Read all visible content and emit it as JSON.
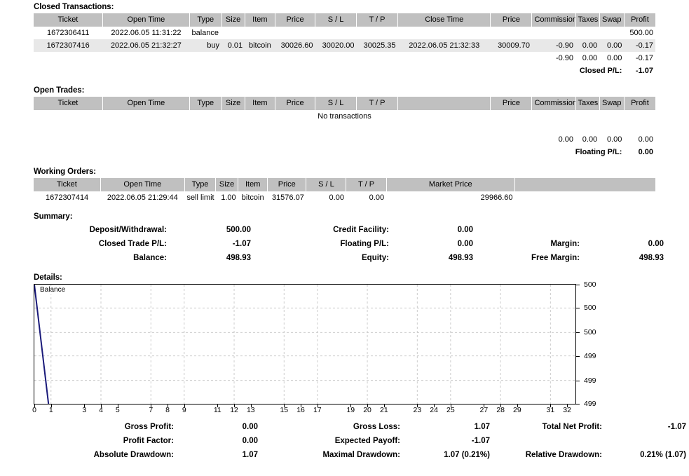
{
  "sections": {
    "closed_title": "Closed Transactions:",
    "open_title": "Open Trades:",
    "working_title": "Working Orders:",
    "summary_title": "Summary:",
    "details_title": "Details:"
  },
  "closed_transactions": {
    "columns": [
      "Ticket",
      "Open Time",
      "Type",
      "Size",
      "Item",
      "Price",
      "S / L",
      "T / P",
      "Close Time",
      "Price",
      "Commission",
      "Taxes",
      "Swap",
      "Profit"
    ],
    "rows": [
      {
        "ticket": "1672306411",
        "open_time": "2022.06.05 11:31:22",
        "type": "balance",
        "size": "",
        "item": "",
        "price": "",
        "sl": "",
        "tp": "",
        "close_time": "",
        "close_price": "",
        "commission": "",
        "taxes": "",
        "swap": "",
        "profit": "500.00"
      },
      {
        "ticket": "1672307416",
        "open_time": "2022.06.05 21:32:27",
        "type": "buy",
        "size": "0.01",
        "item": "bitcoin",
        "price": "30026.60",
        "sl": "30020.00",
        "tp": "30025.35",
        "close_time": "2022.06.05 21:32:33",
        "close_price": "30009.70",
        "commission": "-0.90",
        "taxes": "0.00",
        "swap": "0.00",
        "profit": "-0.17"
      }
    ],
    "totals": {
      "commission": "-0.90",
      "taxes": "0.00",
      "swap": "0.00",
      "profit": "-0.17"
    },
    "pl_label": "Closed P/L:",
    "pl_value": "-1.07"
  },
  "open_trades": {
    "columns": [
      "Ticket",
      "Open Time",
      "Type",
      "Size",
      "Item",
      "Price",
      "S / L",
      "T / P",
      "",
      "Price",
      "Commission",
      "Taxes",
      "Swap",
      "Profit"
    ],
    "empty_message": "No transactions",
    "totals": {
      "commission": "0.00",
      "taxes": "0.00",
      "swap": "0.00",
      "profit": "0.00"
    },
    "pl_label": "Floating P/L:",
    "pl_value": "0.00"
  },
  "working_orders": {
    "columns": [
      "Ticket",
      "Open Time",
      "Type",
      "Size",
      "Item",
      "Price",
      "S / L",
      "T / P",
      "Market Price",
      ""
    ],
    "rows": [
      {
        "ticket": "1672307414",
        "open_time": "2022.06.05 21:29:44",
        "type": "sell limit",
        "size": "1.00",
        "item": "bitcoin",
        "price": "31576.07",
        "sl": "0.00",
        "tp": "0.00",
        "market_price": "29966.60",
        "pad": ""
      }
    ]
  },
  "summary": {
    "rows": [
      {
        "label1": "Deposit/Withdrawal:",
        "value1": "500.00",
        "label2": "Credit Facility:",
        "value2": "0.00",
        "label3": "",
        "value3": ""
      },
      {
        "label1": "Closed Trade P/L:",
        "value1": "-1.07",
        "label2": "Floating P/L:",
        "value2": "0.00",
        "label3": "Margin:",
        "value3": "0.00"
      },
      {
        "label1": "Balance:",
        "value1": "498.93",
        "label2": "Equity:",
        "value2": "498.93",
        "label3": "Free Margin:",
        "value3": "498.93"
      }
    ]
  },
  "statistics": {
    "rows": [
      {
        "label1": "Gross Profit:",
        "value1": "0.00",
        "label2": "Gross Loss:",
        "value2": "1.07",
        "label3": "Total Net Profit:",
        "value3": "-1.07"
      },
      {
        "label1": "Profit Factor:",
        "value1": "0.00",
        "label2": "Expected Payoff:",
        "value2": "-1.07",
        "label3": "",
        "value3": ""
      },
      {
        "label1": "Absolute Drawdown:",
        "value1": "1.07",
        "label2": "Maximal Drawdown:",
        "value2": "1.07 (0.21%)",
        "label3": "Relative Drawdown:",
        "value3": "0.21% (1.07)"
      }
    ]
  },
  "chart_data": {
    "type": "line",
    "title": "",
    "legend": [
      "Balance"
    ],
    "legend_position": "top-left",
    "series": [
      {
        "name": "Balance",
        "color": "#1a1a7a",
        "x": [
          0,
          0.85
        ],
        "values": [
          500.0,
          498.93
        ]
      }
    ],
    "xlabel": "",
    "ylabel": "",
    "x_ticks": [
      0,
      1,
      3,
      4,
      5,
      7,
      8,
      9,
      11,
      12,
      13,
      15,
      16,
      17,
      19,
      20,
      21,
      23,
      24,
      25,
      27,
      28,
      29,
      31,
      32
    ],
    "x_tick_labels": [
      "0",
      "1",
      "3",
      "4",
      "5",
      "7",
      "8",
      "9",
      "11",
      "12",
      "13",
      "15",
      "16",
      "17",
      "19",
      "20",
      "21",
      "23",
      "24",
      "25",
      "27",
      "28",
      "29",
      "31",
      "32"
    ],
    "xlim": [
      0,
      32.5
    ],
    "y_tick_labels": [
      "500",
      "500",
      "500",
      "499",
      "499",
      "499"
    ],
    "y_tick_values": [
      500.0,
      499.79,
      499.57,
      499.36,
      499.14,
      498.93
    ],
    "ylim": [
      498.93,
      500.0
    ],
    "grid": true,
    "grid_color": "#cccccc"
  },
  "colors": {
    "header_bg": "#c0c0c0",
    "alt_row_bg": "#e8e8e8",
    "line": "#1a1a7a",
    "page_bg": "#ffffff",
    "text": "#000000"
  }
}
